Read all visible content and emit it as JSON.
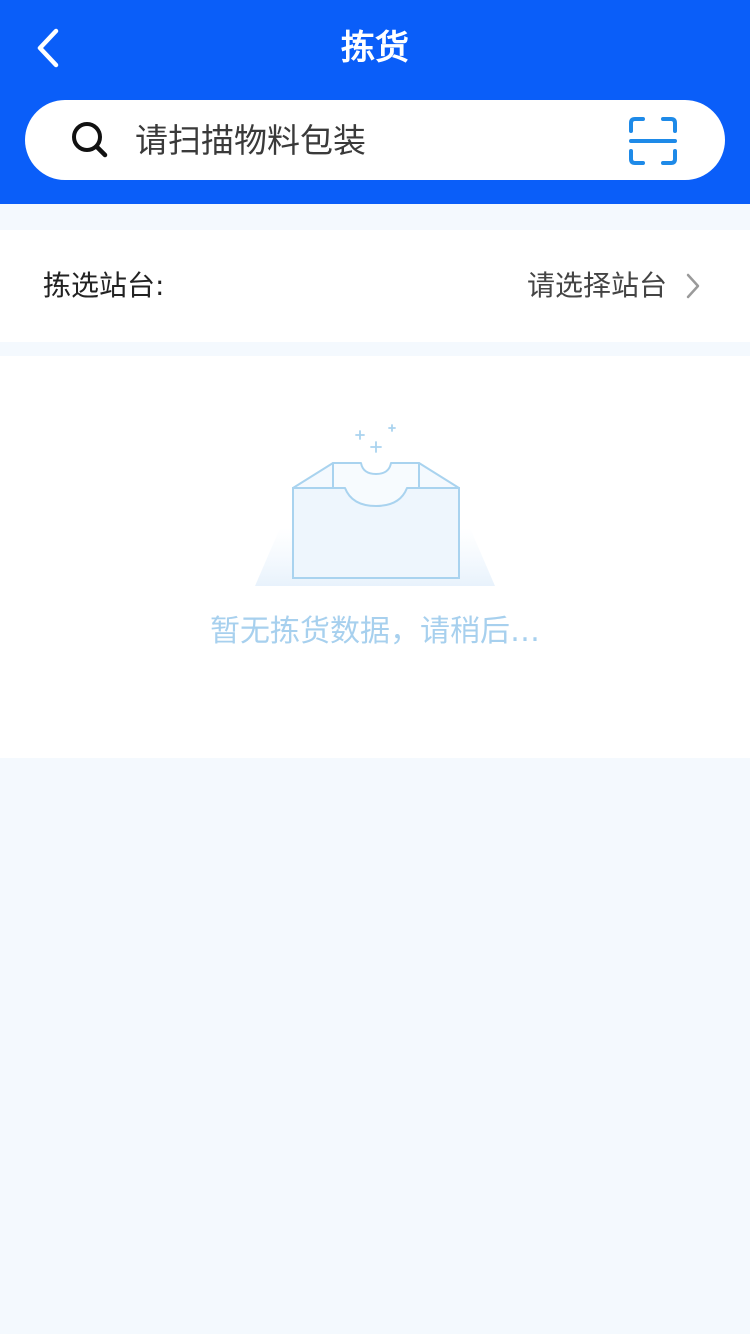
{
  "header": {
    "title": "拣货",
    "back_icon": "chevron-left-icon",
    "background_color": "#0a5ef9"
  },
  "search": {
    "placeholder": "请扫描物料包装",
    "value": "",
    "search_icon": "search-icon",
    "scan_icon": "scan-icon",
    "scan_icon_color": "#1e8ae8"
  },
  "station": {
    "label": "拣选站台:",
    "value": "请选择站台",
    "chevron_icon": "chevron-right-icon"
  },
  "empty_state": {
    "illustration": "empty-box-icon",
    "message": "暂无拣货数据，请稍后…",
    "text_color": "#a7d0ee"
  }
}
